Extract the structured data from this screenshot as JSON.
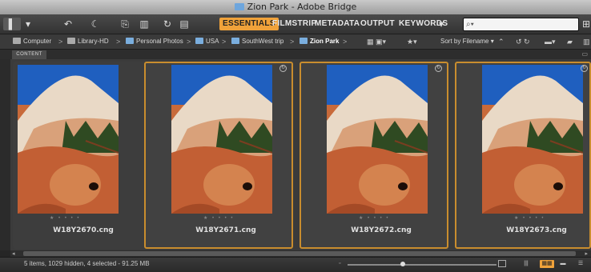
{
  "window": {
    "title": "Zion Park - Adobe Bridge"
  },
  "toolbar": {
    "icons": [
      "boomerang-icon",
      "go-back-icon",
      "go-forward-icon",
      "get-photos-icon",
      "refine-icon",
      "rotate-icon",
      "open-recent-icon"
    ],
    "workspaces": [
      {
        "label": "ESSENTIALS",
        "active": true
      },
      {
        "label": "FILMSTRIP",
        "active": false
      },
      {
        "label": "METADATA",
        "active": false
      },
      {
        "label": "OUTPUT",
        "active": false
      },
      {
        "label": "KEYWORDS",
        "active": false
      }
    ],
    "search_placeholder": ""
  },
  "path": {
    "crumbs": [
      "Computer",
      "Library-HD",
      "Personal Photos",
      "USA",
      "SouthWest trip",
      "Zion Park"
    ],
    "sort_label": "Sort by Filename"
  },
  "panel": {
    "tab": "CONTENT"
  },
  "thumbnails": [
    {
      "filename": "W18Y2670.cng",
      "selected": false
    },
    {
      "filename": "W18Y2671.cng",
      "selected": true
    },
    {
      "filename": "W18Y2672.cng",
      "selected": true
    },
    {
      "filename": "W18Y2673.cng",
      "selected": true
    }
  ],
  "status": {
    "text": "5 items, 1029 hidden, 4 selected - 91.25 MB",
    "zoom_level": 0.37
  },
  "colors": {
    "accent": "#f0a23a",
    "selection_border": "#c98d2e",
    "background": "#3b3b3b"
  }
}
